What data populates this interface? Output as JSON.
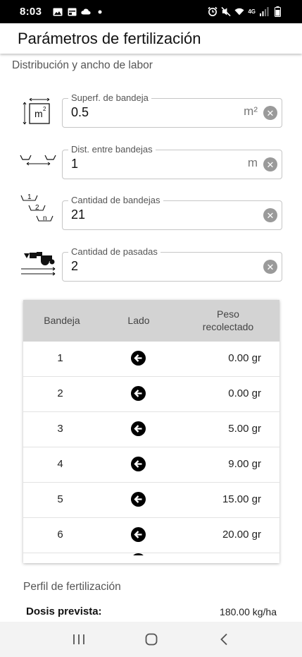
{
  "status_bar": {
    "time": "8:03",
    "network": "4G"
  },
  "app_bar": {
    "title": "Parámetros de fertilización"
  },
  "section": {
    "title": "Distribución y ancho de labor"
  },
  "fields": [
    {
      "label": "Superf. de bandeja",
      "value": "0.5",
      "unit": "m²",
      "icon": "tray-area-icon",
      "icon_text": "m"
    },
    {
      "label": "Dist. entre bandejas",
      "value": "1",
      "unit": "m",
      "icon": "tray-distance-icon"
    },
    {
      "label": "Cantidad de bandejas",
      "value": "21",
      "unit": "",
      "icon": "tray-count-icon",
      "icon_labels": [
        "1",
        "2",
        "n"
      ]
    },
    {
      "label": "Cantidad de pasadas",
      "value": "2",
      "unit": "",
      "icon": "tractor-passes-icon"
    }
  ],
  "table": {
    "headers": {
      "bandeja": "Bandeja",
      "lado": "Lado",
      "peso": "Peso recolectado"
    },
    "rows": [
      {
        "bandeja": "1",
        "lado": "left-arrow-icon",
        "peso": "0.00 gr"
      },
      {
        "bandeja": "2",
        "lado": "left-arrow-icon",
        "peso": "0.00 gr"
      },
      {
        "bandeja": "3",
        "lado": "left-arrow-icon",
        "peso": "5.00 gr"
      },
      {
        "bandeja": "4",
        "lado": "left-arrow-icon",
        "peso": "9.00 gr"
      },
      {
        "bandeja": "5",
        "lado": "left-arrow-icon",
        "peso": "15.00 gr"
      },
      {
        "bandeja": "6",
        "lado": "left-arrow-icon",
        "peso": "20.00 gr"
      }
    ]
  },
  "profile": {
    "title": "Perfil de fertilización",
    "dose_label": "Dosis prevista:",
    "dose_value": "180.00 kg/ha"
  },
  "nav": {
    "recents": "recents-icon",
    "home": "home-icon",
    "back": "back-icon"
  },
  "colors": {
    "status_bar": "#000000",
    "header_gray": "#d3d3d3",
    "clear_button": "#9a9a9a"
  }
}
